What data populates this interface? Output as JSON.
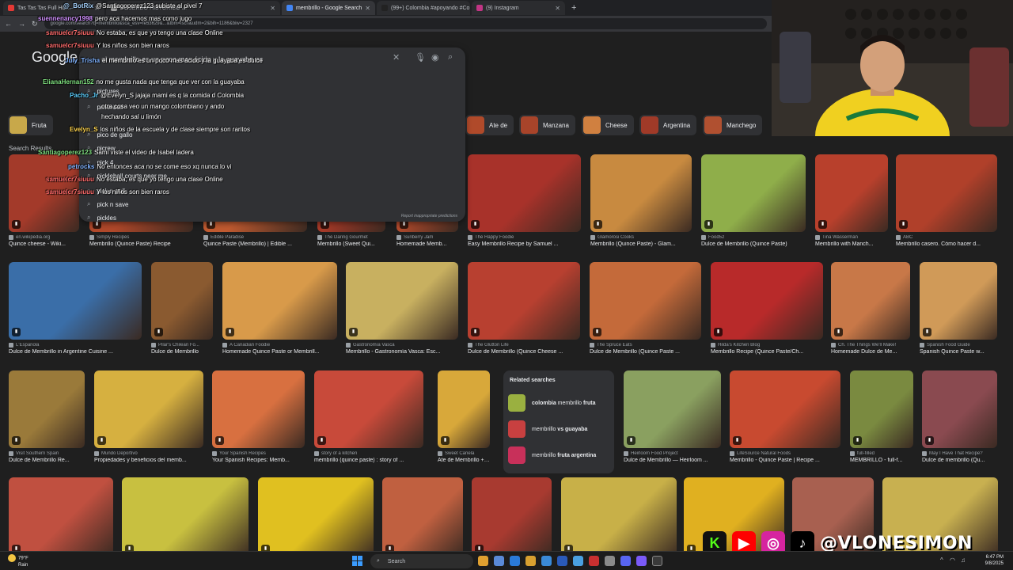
{
  "browser": {
    "tabs": [
      {
        "title": "Tas Tas Tas Full HD...",
        "color": "#e53935"
      },
      {
        "title": "ACUERDO HISTORICO ⚠",
        "color": "#9e9e9e"
      },
      {
        "title": "membrillo - Google Search",
        "color": "#4285f4",
        "active": true
      },
      {
        "title": "(99+) Colombia #apoyando #Co...",
        "color": "#222222"
      },
      {
        "title": "(9) Instagram",
        "color": "#c13584"
      }
    ],
    "new_tab": "+",
    "url": "google.com/search?q=membrillo&sca_esv=fe53629&...&tbm=isch&udm=2&bih=1186&biw=2327"
  },
  "google": {
    "logo": "Google",
    "query": "el membrillo es un poco mas ácido y la guayaba es",
    "suggestions": [
      "pictures",
      "pickleball",
      "pico de gallo",
      "picrew",
      "pick 4",
      "pickleball courts near me",
      "pick n pull",
      "pick n save",
      "pickles"
    ],
    "report": "Report inappropriate predictions",
    "chips": [
      {
        "label": "Fruta",
        "color": "#c8a84a"
      },
      {
        "label": "Ate de",
        "color": "#b04a2a"
      },
      {
        "label": "Manzana",
        "color": "#a8442a"
      },
      {
        "label": "Cheese",
        "color": "#d08040"
      },
      {
        "label": "Argentina",
        "color": "#a03a28"
      },
      {
        "label": "Manchego",
        "color": "#b05030"
      }
    ],
    "results_label": "Search Results",
    "rows": [
      [
        {
          "src": "en.wikipedia.org",
          "title": "Quince cheese - Wiki...",
          "color": "#a33a2a"
        },
        {
          "src": "Simply Recipes",
          "title": "Membrillo (Quince Paste) Recipe",
          "color": "#b0482a"
        },
        {
          "src": "Edible Paradise",
          "title": "Quince Paste (Membrillo) | Edible ...",
          "color": "#c05a30"
        },
        {
          "src": "The Daring Gourmet",
          "title": "Membrillo (Sweet Qui...",
          "color": "#a83a28"
        },
        {
          "src": "Sunberry Jam",
          "title": "Homemade Memb...",
          "color": "#b24a2c"
        },
        {
          "src": "The Happy Foodie",
          "title": "Easy Membrillo Recipe by Samuel ...",
          "color": "#a8322a"
        },
        {
          "src": "Glamorosi Cooks",
          "title": "Membrillo (Quince Paste) - Glam...",
          "color": "#c88a40"
        },
        {
          "src": "Food52",
          "title": "Dulce de Membrillo (Quince Paste)",
          "color": "#8fae4a"
        },
        {
          "src": "Tina Wasserman",
          "title": "Membrillo with Manch...",
          "color": "#b8402c"
        },
        {
          "src": "ABC",
          "title": "Membrillo casero. Cómo hacer d...",
          "color": "#b0402a"
        }
      ],
      [
        {
          "src": "L'Española",
          "title": "Dulce de Membrillo in Argentine Cuisine ...",
          "color": "#3a6ea8"
        },
        {
          "src": "Pilar's Chilean Fo...",
          "title": "Dulce de Membrillo",
          "color": "#8a5a30"
        },
        {
          "src": "A Canadian Foodie",
          "title": "Homemade Quince Paste or Membrill...",
          "color": "#d89a4a"
        },
        {
          "src": "Gastronomía Vasca",
          "title": "Membrillo - Gastronomía Vasca: Esc...",
          "color": "#c8b060"
        },
        {
          "src": "The Glutton Life",
          "title": "Dulce de Membrillo (Quince Cheese ...",
          "color": "#b84030"
        },
        {
          "src": "The Spruce Eats",
          "title": "Dulce de Membrillo (Quince Paste ...",
          "color": "#c46a3a"
        },
        {
          "src": "Hilda's Kitchen Blog",
          "title": "Membrillo Recipe (Quince Paste/Ch...",
          "color": "#b82a2a"
        },
        {
          "src": "Ch. The Things We'll Make!",
          "title": "Homemade Dulce de Me...",
          "color": "#c87848"
        },
        {
          "src": "Spanish Food Guide",
          "title": "Spanish Quince Paste w...",
          "color": "#d09a58"
        }
      ],
      [
        {
          "src": "Visit Southern Spain",
          "title": "Dulce de Membrillo Re...",
          "color": "#9a7a3a"
        },
        {
          "src": "Mundo Deportivo",
          "title": "Propiedades y beneficios del memb...",
          "color": "#d6b040"
        },
        {
          "src": "Your Spanish Recipes",
          "title": "Your Spanish Recipes: Memb...",
          "color": "#d87040"
        },
        {
          "src": "story of a kitchen",
          "title": "membrillo (quince paste) : story of ...",
          "color": "#c84a3a"
        },
        {
          "src": "Sweet Canela",
          "title": "Ate de Membrillo + ...",
          "color": "#d8a83a"
        },
        {
          "src": "Heirloom Food Project",
          "title": "Dulce de Membrillo — Heirloom ...",
          "color": "#8aa060"
        },
        {
          "src": "LifeSource Natural Foods",
          "title": "Membrillo - Quince Paste | Recipe ...",
          "color": "#c84a30"
        },
        {
          "src": "full-filled",
          "title": "MEMBRILLO - full-f...",
          "color": "#7a8a40"
        },
        {
          "src": "May I Have That Recipe?",
          "title": "Dulce de membrillo (Qu...",
          "color": "#8a4a50"
        }
      ],
      [
        {
          "title": "",
          "src": "",
          "color": "#c05040"
        },
        {
          "title": "",
          "src": "",
          "color": "#c8c040"
        },
        {
          "title": "",
          "src": "",
          "color": "#e0c020"
        },
        {
          "title": "",
          "src": "",
          "color": "#c06040"
        },
        {
          "title": "",
          "src": "",
          "color": "#a83a30"
        },
        {
          "title": "",
          "src": "",
          "color": "#c8b048"
        },
        {
          "title": "",
          "src": "",
          "color": "#e0b020"
        },
        {
          "title": "",
          "src": "",
          "color": "#a86050"
        },
        {
          "title": "",
          "src": "",
          "color": "#c8b050"
        }
      ]
    ],
    "related": {
      "heading": "Related searches",
      "items": [
        {
          "bold": "colombia",
          "rest1": " membrillo ",
          "bold2": "fruta",
          "color": "#9ab040"
        },
        {
          "bold": "",
          "rest1": "membrillo ",
          "bold2": "vs guayaba",
          "color": "#c84040"
        },
        {
          "bold": "",
          "rest1": "membrillo ",
          "bold2": "fruta argentina",
          "color": "#c8305a"
        }
      ]
    }
  },
  "chat": [
    {
      "user": "@_BotRix",
      "msg": "@Santiagoperez123 subiste al pivel 7",
      "color": "#a7d4ff"
    },
    {
      "user": "suennenancy1998",
      "msg": "pero aca hacemos mas como jugo",
      "color": "#d08fff"
    },
    {
      "user": "samuelcr7siuuu",
      "msg": "No estaba, es que yo tengo una clase Online",
      "color": "#ff6b6b"
    },
    {
      "user": "samuelcr7siuuu",
      "msg": "Y los niños son bien raros",
      "color": "#ff6b6b"
    },
    {
      "user": "July_Trisha",
      "msg": "el membrillo es un poco mas ácido y la guayaba es dulce",
      "color": "#7fb2ff"
    },
    {
      "user": "ElianaHernan152",
      "msg": "no me gusta nada que tenga que ver con la guayaba",
      "color": "#7fe07f"
    },
    {
      "user": "Pacho_Jr",
      "msg": "@Evelyn_S jajaja mami es q la comida d Colombia",
      "color": "#5cd0ff"
    },
    {
      "user": "",
      "msg": "otra cosa veo un mango colombiano y ando",
      "color": "#ffffff"
    },
    {
      "user": "",
      "msg": "hechando sal u limón",
      "color": "#ffffff"
    },
    {
      "user": "Evelyn_S",
      "msg": "los niños de la escuela y de clase siempre son raritos",
      "color": "#ffd54f"
    },
    {
      "user": "Santiagoperez123",
      "msg": "Sami viste el video de Isabel ladera",
      "color": "#7fe07f"
    },
    {
      "user": "petrocks",
      "msg": "No entonces aca no se come eso xq nunca lo vi",
      "color": "#7fb2ff"
    },
    {
      "user": "samuelcr7siuuu",
      "msg": "No estaba, es que yo tengo una clase Online",
      "color": "#ff6b6b"
    },
    {
      "user": "samuelcr7siuuu",
      "msg": "Y los niños son bien raros",
      "color": "#ff6b6b"
    }
  ],
  "overlay": {
    "handle": "@VLONESIMON",
    "social_colors": {
      "kick": "#53fc18",
      "youtube": "#ff0000",
      "instagram": "#d6249f",
      "tiktok": "#000000"
    }
  },
  "taskbar": {
    "temp": "79°F",
    "weather": "Rain",
    "search": "Search",
    "time": "6:47 PM",
    "date": "9/8/2025"
  }
}
